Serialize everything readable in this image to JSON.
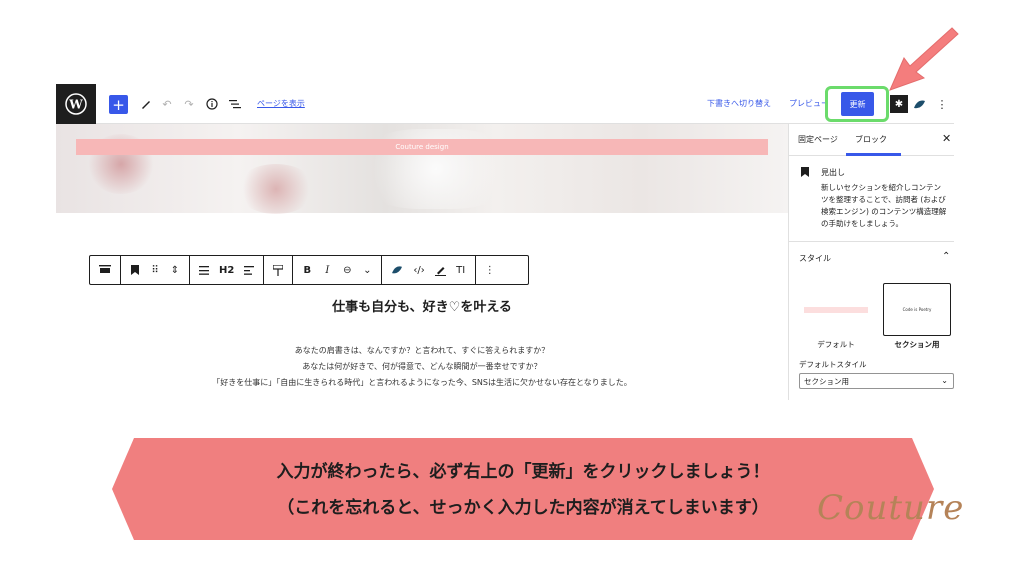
{
  "toolbar": {
    "page_link": "ページを表示",
    "draft_switch": "下書きへ切り替え",
    "preview": "プレビュー",
    "update": "更新"
  },
  "canvas": {
    "hero_band_text": "Couture design",
    "heading": "仕事も自分も、好き♡を叶える",
    "paragraph": [
      "あなたの肩書きは、なんですか？と言われて、すぐに答えられますか？",
      "あなたは何が好きで、何が得意で、どんな瞬間が一番幸せですか？",
      "「好きを仕事に」「自由に生きられる時代」と言われるようになった今、SNSは生活に欠かせない存在となりました。"
    ]
  },
  "block_toolbar": {
    "heading_level": "H2"
  },
  "sidebar": {
    "tabs": [
      "固定ページ",
      "ブロック"
    ],
    "active_tab": "ブロック",
    "block_name": "見出し",
    "block_description": "新しいセクションを紹介しコンテンツを整理することで、訪問者 (および検索エンジン) のコンテンツ構造理解の手助けをしましょう。",
    "styles_title": "スタイル",
    "style_options": [
      "デフォルト",
      "セクション用"
    ],
    "selected_style": "セクション用",
    "section_preview_text": "Code is Poetry",
    "default_style_label": "デフォルトスタイル",
    "default_style_value": "セクション用"
  },
  "banner": {
    "line1": "入力が終わったら、必ず右上の「更新」をクリックしましょう！",
    "line2": "（これを忘れると、せっかく入力した内容が消えてしまいます）",
    "color": "#f07f7f"
  },
  "brand": {
    "signature": "Couture"
  },
  "colors": {
    "accent": "#3858e9",
    "highlight": "#6bdb6b",
    "arrow": "#f47d7d"
  }
}
